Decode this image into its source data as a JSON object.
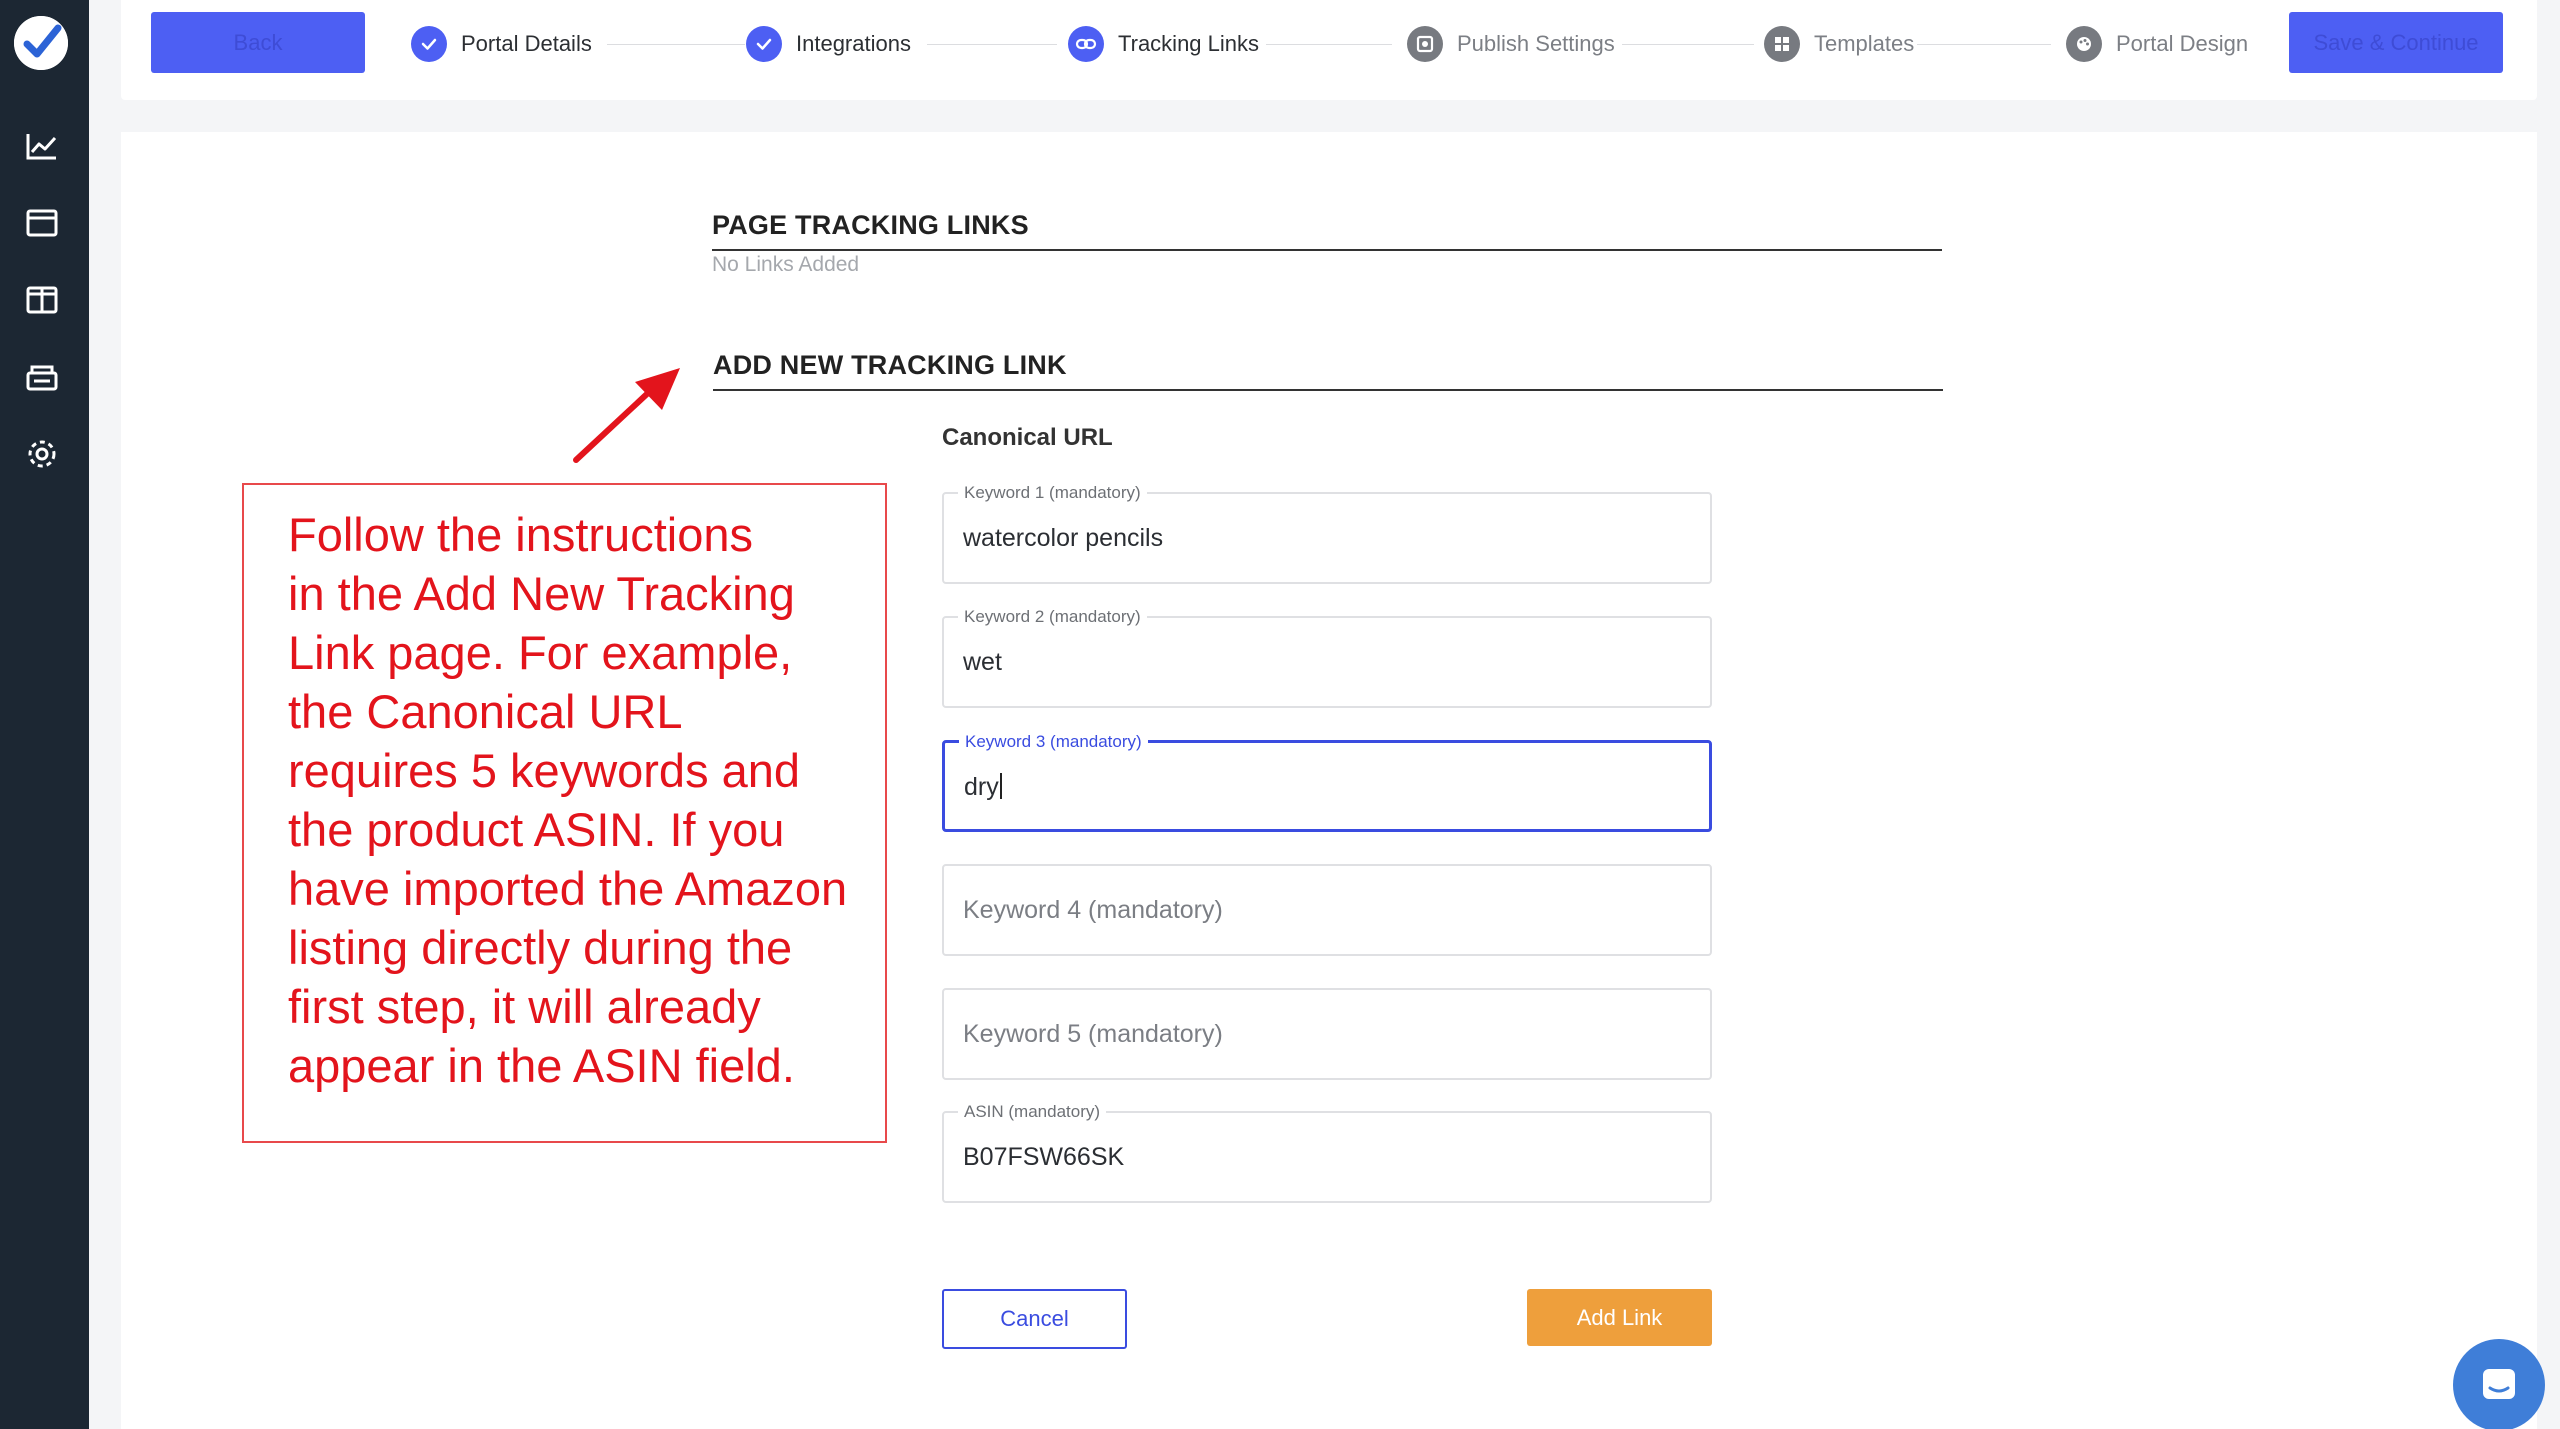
{
  "sidebar": {
    "icons": [
      "logo-check-icon",
      "analytics-icon",
      "browser-window-icon",
      "layout-columns-icon",
      "inbox-stack-icon",
      "gear-icon"
    ]
  },
  "toolbar": {
    "back_label": "Back",
    "save_label": "Save & Continue"
  },
  "steps": [
    {
      "label": "Portal Details",
      "state": "done",
      "icon": "check-icon"
    },
    {
      "label": "Integrations",
      "state": "done",
      "icon": "check-icon"
    },
    {
      "label": "Tracking Links",
      "state": "active",
      "icon": "link-icon"
    },
    {
      "label": "Publish Settings",
      "state": "todo",
      "icon": "publish-icon"
    },
    {
      "label": "Templates",
      "state": "todo",
      "icon": "templates-icon"
    },
    {
      "label": "Portal Design",
      "state": "todo",
      "icon": "palette-icon"
    }
  ],
  "page_links": {
    "title": "PAGE TRACKING LINKS",
    "empty_text": "No Links Added"
  },
  "new_link": {
    "title": "ADD NEW TRACKING LINK",
    "canonical_label": "Canonical URL",
    "fields": [
      {
        "label": "Keyword 1 (mandatory)",
        "value": "watercolor pencils",
        "placeholder": ""
      },
      {
        "label": "Keyword 2 (mandatory)",
        "value": "wet",
        "placeholder": ""
      },
      {
        "label": "Keyword 3 (mandatory)",
        "value": "dry",
        "placeholder": "",
        "focused": true
      },
      {
        "label": "",
        "value": "",
        "placeholder": "Keyword 4 (mandatory)"
      },
      {
        "label": "",
        "value": "",
        "placeholder": "Keyword 5 (mandatory)"
      },
      {
        "label": "ASIN (mandatory)",
        "value": "B07FSW66SK",
        "placeholder": ""
      }
    ],
    "cancel_label": "Cancel",
    "add_label": "Add Link"
  },
  "annotation": {
    "lines": [
      "Follow the instructions",
      "in the Add New Tracking",
      "Link page. For example,",
      "the Canonical URL",
      "requires 5 keywords and",
      "the product ASIN. If you",
      "have imported the Amazon",
      "listing directly during the",
      "first step, it will already",
      "appear in the ASIN field."
    ]
  },
  "colors": {
    "sidebar": "#1c2733",
    "primary": "#4d5ff3",
    "accent_orange": "#ee9f3c",
    "annotation_red": "#e3141c",
    "chat_blue": "#3f7ed8"
  }
}
